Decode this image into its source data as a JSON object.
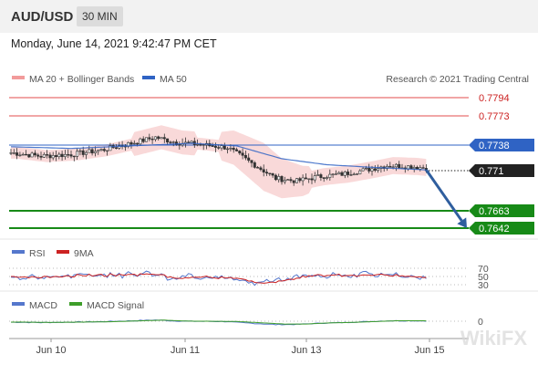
{
  "header": {
    "symbol": "AUD/USD",
    "timeframe": "30 MIN"
  },
  "datetime": "Monday, June 14, 2021 9:42:47 PM CET",
  "legend": {
    "bollinger": "MA 20 + Bollinger Bands",
    "ma50": "MA 50"
  },
  "research_note": "Research © 2021 Trading Central",
  "rsi": {
    "label": "RSI",
    "signal_label": "9MA",
    "levels": [
      "70",
      "50",
      "30"
    ]
  },
  "macd": {
    "label": "MACD",
    "signal_label": "MACD Signal",
    "zero": "0"
  },
  "watermark": "WikiFX",
  "colors": {
    "resistance": "#e34c4c",
    "support": "#178a17",
    "current": "#222222",
    "ma50": "#2f63c4",
    "bollinger_fill": "#f8c9c9",
    "candle_up": "#ffffff",
    "candle_down": "#333333",
    "projection": "#2f5e9e",
    "rsi": "#5577cc",
    "rsi_ma": "#cc2222",
    "macd": "#5577cc",
    "macd_signal": "#3d9e2a"
  },
  "chart_data": {
    "type": "candlestick",
    "symbol": "AUD/USD",
    "timeframe": "30 MIN",
    "x_ticks": [
      "Jun 10",
      "Jun 11",
      "Jun 13",
      "Jun 15"
    ],
    "ylim": [
      0.7635,
      0.78
    ],
    "levels": {
      "resistance": [
        0.7794,
        0.7773
      ],
      "ma50_tag": 0.7738,
      "current": 0.771,
      "support": [
        0.7663,
        0.7642
      ]
    },
    "close_path": [
      [
        0,
        0.773
      ],
      [
        10,
        0.7726
      ],
      [
        20,
        0.7728
      ],
      [
        30,
        0.7733
      ],
      [
        40,
        0.7741
      ],
      [
        48,
        0.7748
      ],
      [
        55,
        0.7742
      ],
      [
        62,
        0.774
      ],
      [
        72,
        0.7736
      ],
      [
        80,
        0.7718
      ],
      [
        88,
        0.77
      ],
      [
        95,
        0.7697
      ],
      [
        102,
        0.7702
      ],
      [
        110,
        0.7705
      ],
      [
        118,
        0.771
      ],
      [
        125,
        0.7715
      ],
      [
        133,
        0.7714
      ],
      [
        138,
        0.7712
      ]
    ],
    "ma50_path": [
      [
        0,
        0.7737
      ],
      [
        20,
        0.7735
      ],
      [
        40,
        0.7738
      ],
      [
        60,
        0.7741
      ],
      [
        75,
        0.7738
      ],
      [
        90,
        0.7723
      ],
      [
        105,
        0.7716
      ],
      [
        120,
        0.7713
      ],
      [
        138,
        0.771
      ]
    ],
    "projection": [
      [
        138,
        0.771
      ],
      [
        150,
        0.7642
      ]
    ]
  }
}
